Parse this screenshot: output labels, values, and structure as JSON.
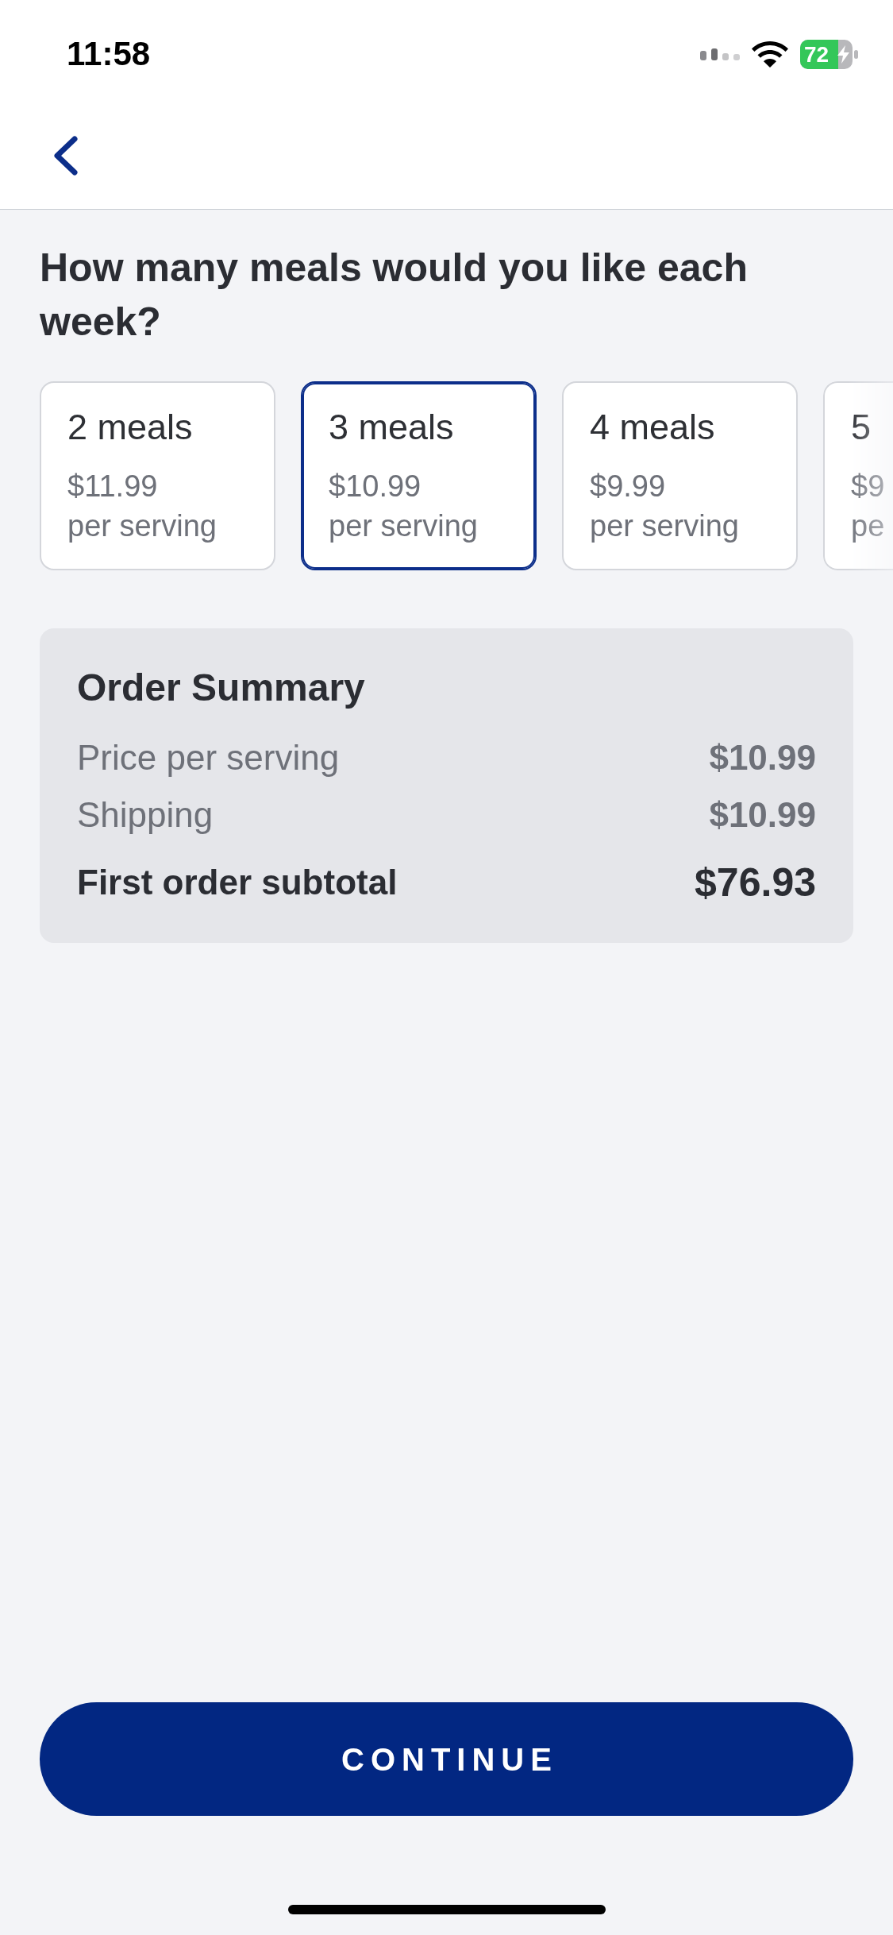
{
  "status_bar": {
    "time": "11:58",
    "battery_percent": "72"
  },
  "question": "How many meals would you like each week?",
  "meal_options": [
    {
      "title": "2 meals",
      "price": "$11.99",
      "unit": "per serving",
      "selected": false
    },
    {
      "title": "3 meals",
      "price": "$10.99",
      "unit": "per serving",
      "selected": true
    },
    {
      "title": "4 meals",
      "price": "$9.99",
      "unit": "per serving",
      "selected": false
    },
    {
      "title": "5",
      "price": "$9",
      "unit": "pe",
      "selected": false
    }
  ],
  "order_summary": {
    "title": "Order Summary",
    "rows": [
      {
        "kind": "line",
        "label": "Price per serving",
        "value": "$10.99"
      },
      {
        "kind": "line",
        "label": "Shipping",
        "value": "$10.99"
      },
      {
        "kind": "total",
        "label": "First order subtotal",
        "value": "$76.93"
      }
    ]
  },
  "continue_button": {
    "label": "CONTINUE"
  }
}
